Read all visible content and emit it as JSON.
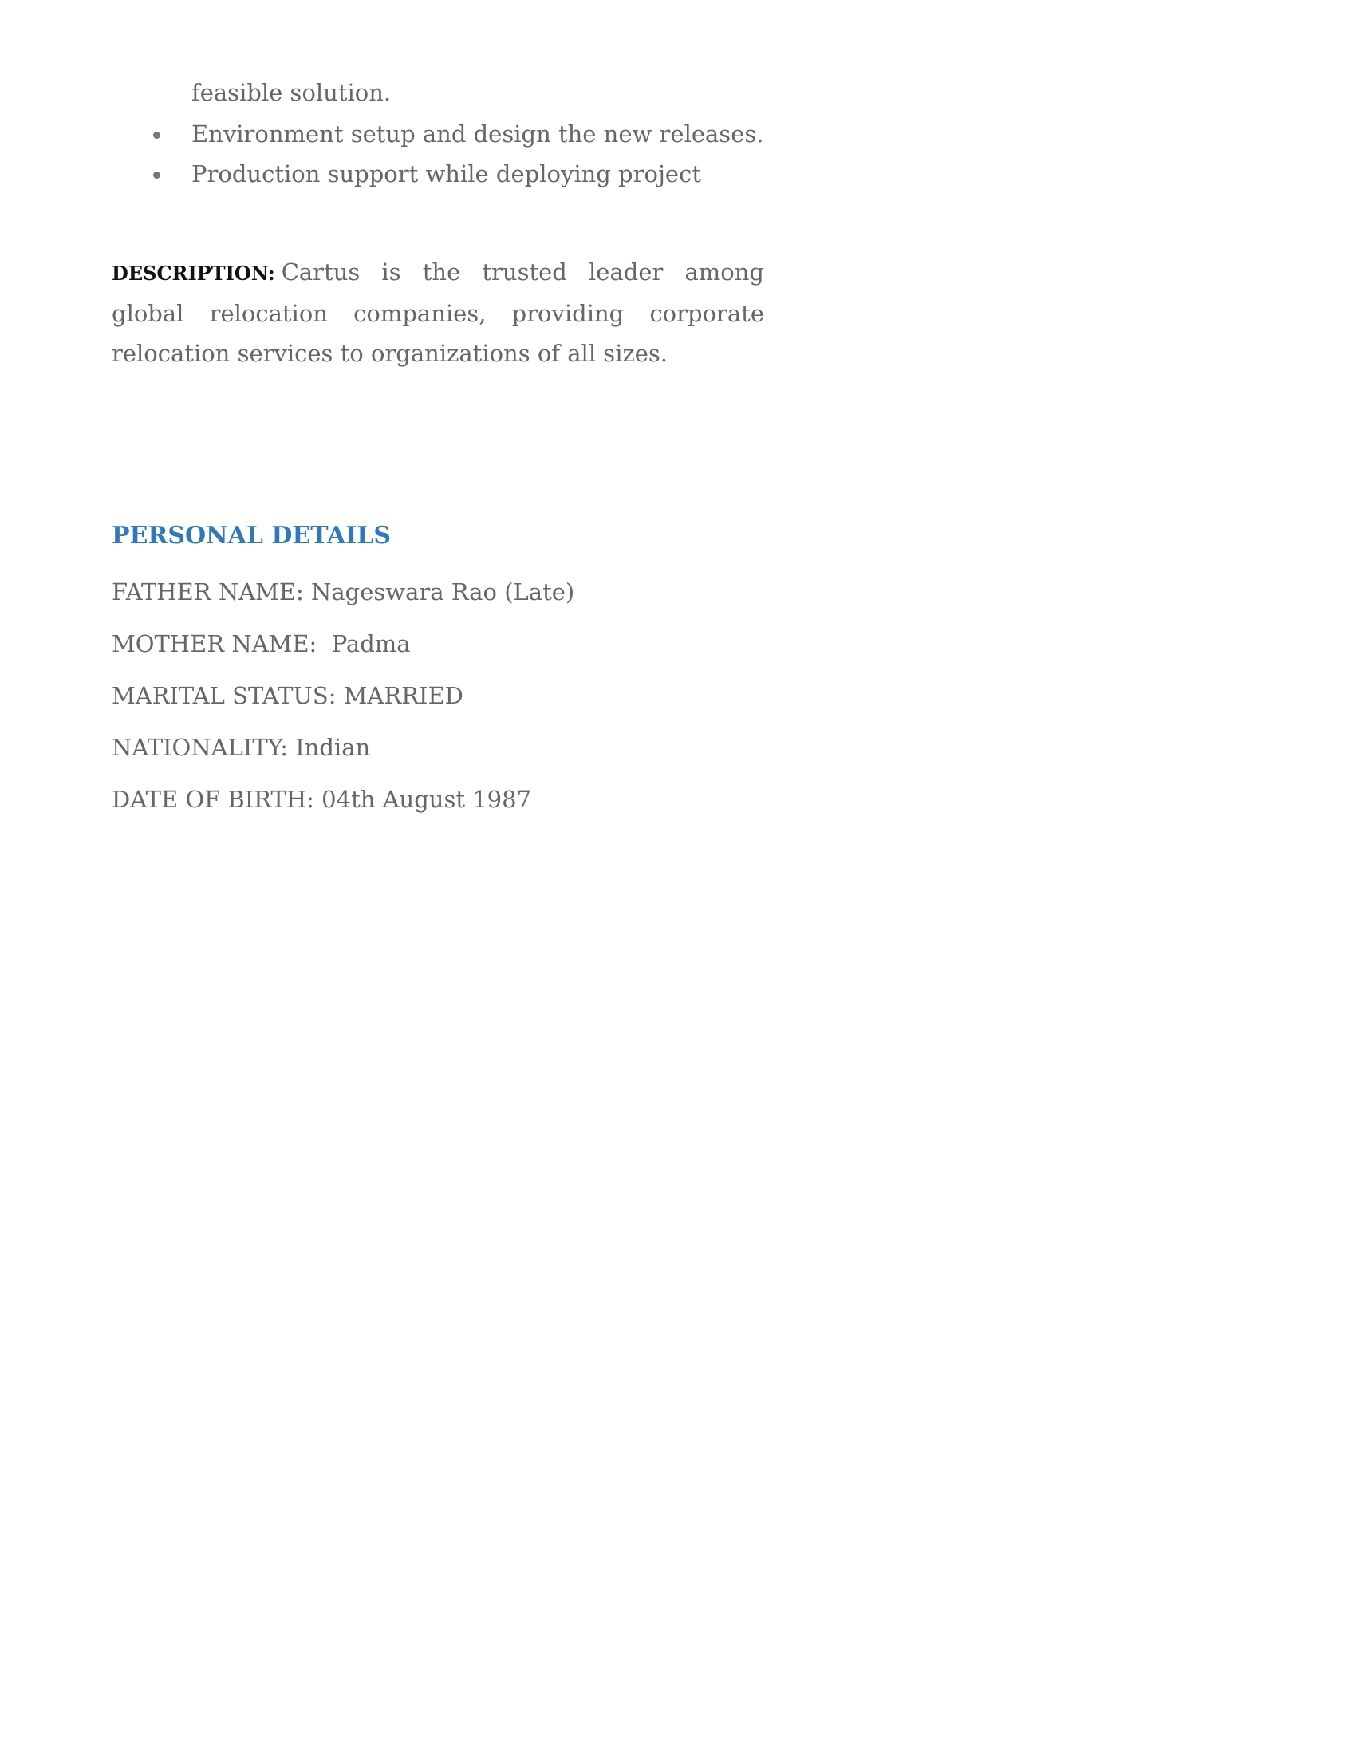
{
  "experience": {
    "continued_line": "feasible solution.",
    "bullets": [
      "Environment setup and design the new releases.",
      "Production support while deploying project"
    ],
    "description_label": "DESCRIPTION:",
    "description_text": "Cartus is the trusted leader among global relocation companies, providing corporate relocation services to organizations of all sizes."
  },
  "personal_details": {
    "heading": "PERSONAL DETAILS",
    "father": "FATHER NAME: Nageswara Rao (Late)",
    "mother": "MOTHER NAME:  Padma",
    "marital_status": "MARITAL STATUS: MARRIED",
    "nationality": "NATIONALITY: Indian",
    "dob": "DATE OF BIRTH: 04th August 1987"
  },
  "colors": {
    "heading": "#2e79bd",
    "body_text": "#666666",
    "label_text": "#111111"
  }
}
